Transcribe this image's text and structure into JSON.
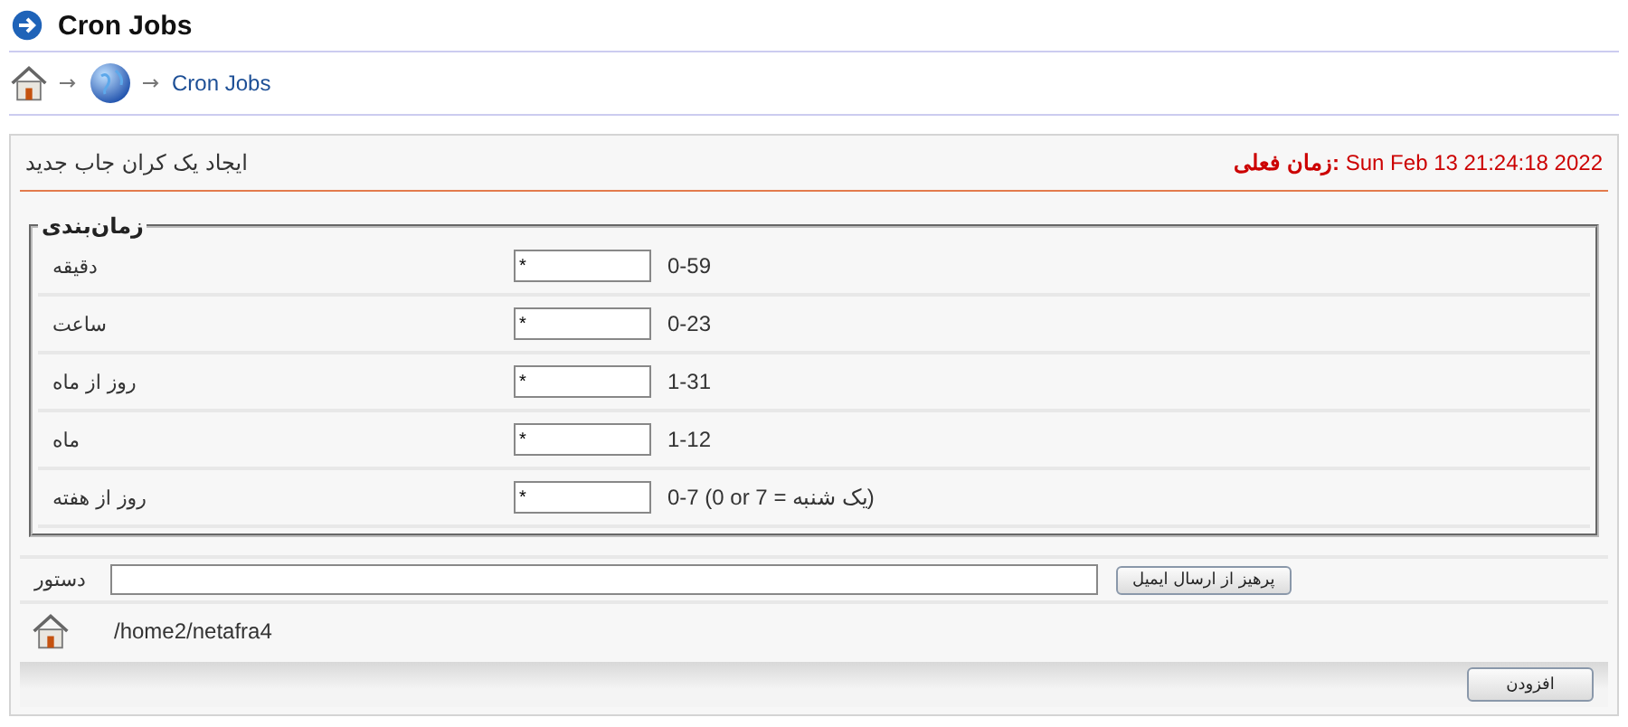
{
  "page_title": "Cron Jobs",
  "breadcrumb": {
    "current": "Cron Jobs"
  },
  "panel": {
    "title": "ایجاد یک کران جاب جدید",
    "clock_label": "زمان فعلی:",
    "clock_value": "Sun Feb 13 21:24:18 2022"
  },
  "schedule": {
    "legend": "زمان‌بندی",
    "rows": [
      {
        "label": "دقیقه",
        "value": "*",
        "range": "0-59"
      },
      {
        "label": "ساعت",
        "value": "*",
        "range": "0-23"
      },
      {
        "label": "روز از ماه",
        "value": "*",
        "range": "1-31"
      },
      {
        "label": "ماه",
        "value": "*",
        "range": "1-12"
      },
      {
        "label": "روز از هفته",
        "value": "*",
        "range": "0-7 (0 or 7 = یک شنبه)"
      }
    ]
  },
  "command": {
    "label": "دستور",
    "button": "پرهیز از ارسال ایمیل"
  },
  "home_path": "/home2/netafra4",
  "submit_button": "افزودن"
}
